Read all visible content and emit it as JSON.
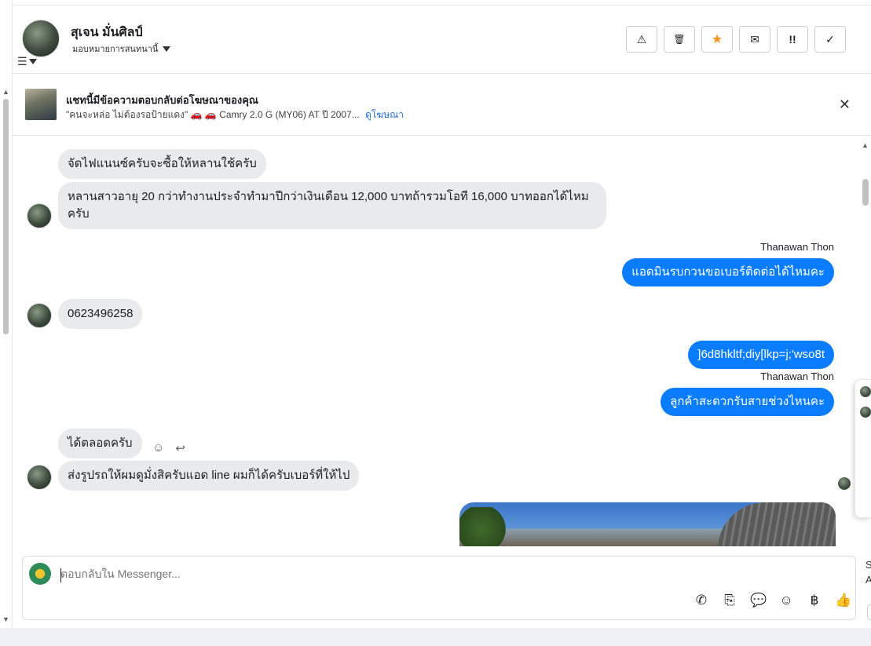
{
  "header": {
    "contact_name": "สุเจน มั่นศิลป์",
    "assign_label": "มอบหมายการสนทนานี้",
    "actions": [
      {
        "name": "spam-button",
        "icon": "⚠"
      },
      {
        "name": "delete-button",
        "icon": "🗑"
      },
      {
        "name": "star-button",
        "icon": "★"
      },
      {
        "name": "mark-unread-button",
        "icon": "✉"
      },
      {
        "name": "follow-up-button",
        "icon": "!!"
      },
      {
        "name": "done-button",
        "icon": "✓"
      }
    ]
  },
  "ad": {
    "title": "แชทนี้มีข้อความตอบกลับต่อโฆษณาของคุณ",
    "subtitle": "\"คนจะหล่อ ไม่ต้องรอป้ายแดง\" 🚗 🚗 Camry 2.0 G (MY06) AT ปี 2007...",
    "link": "ดูโฆษณา"
  },
  "messages": [
    {
      "dir": "in",
      "text": "จัดไฟแนนซ์ครับจะซื้อให้หลานใช้ครับ"
    },
    {
      "dir": "in",
      "text": "หลานสาวอายุ 20 กว่าทำงานประจำทำมาปีกว่าเงินเดือน 12,000 บาทถ้ารวมโอที 16,000 บาทออกได้ไหมครับ"
    },
    {
      "dir": "out",
      "sender": "Thanawan Thon",
      "text": "แอดมินรบกวนขอเบอร์ติดต่อได้ไหมคะ"
    },
    {
      "dir": "in",
      "text": "0623496258"
    },
    {
      "dir": "out",
      "text": "]6d8hkltf;diy[lkp=j;'wso8t"
    },
    {
      "dir": "out",
      "sender": "Thanawan Thon",
      "text": "ลูกค้าสะดวกรับสายช่วงไหนคะ"
    },
    {
      "dir": "in",
      "text": "ได้ตลอดครับ"
    },
    {
      "dir": "in",
      "text": "ส่งรูปรถให้ผมดูมั่งสิครับแอด line ผมก็ได้ครับเบอร์ที่ให้ไป"
    }
  ],
  "composer": {
    "placeholder": "ตอบกลับใน Messenger...",
    "tools": [
      "phone-plus-icon",
      "attach-icon",
      "saved-reply-icon",
      "emoji-icon",
      "baht-icon",
      "like-icon"
    ]
  },
  "right_edge": {
    "letters": [
      "S",
      "A"
    ]
  },
  "colors": {
    "outgoing": "#0a7cff",
    "incoming": "#e9eaec",
    "link": "#216fdb",
    "star": "#f7931e"
  }
}
